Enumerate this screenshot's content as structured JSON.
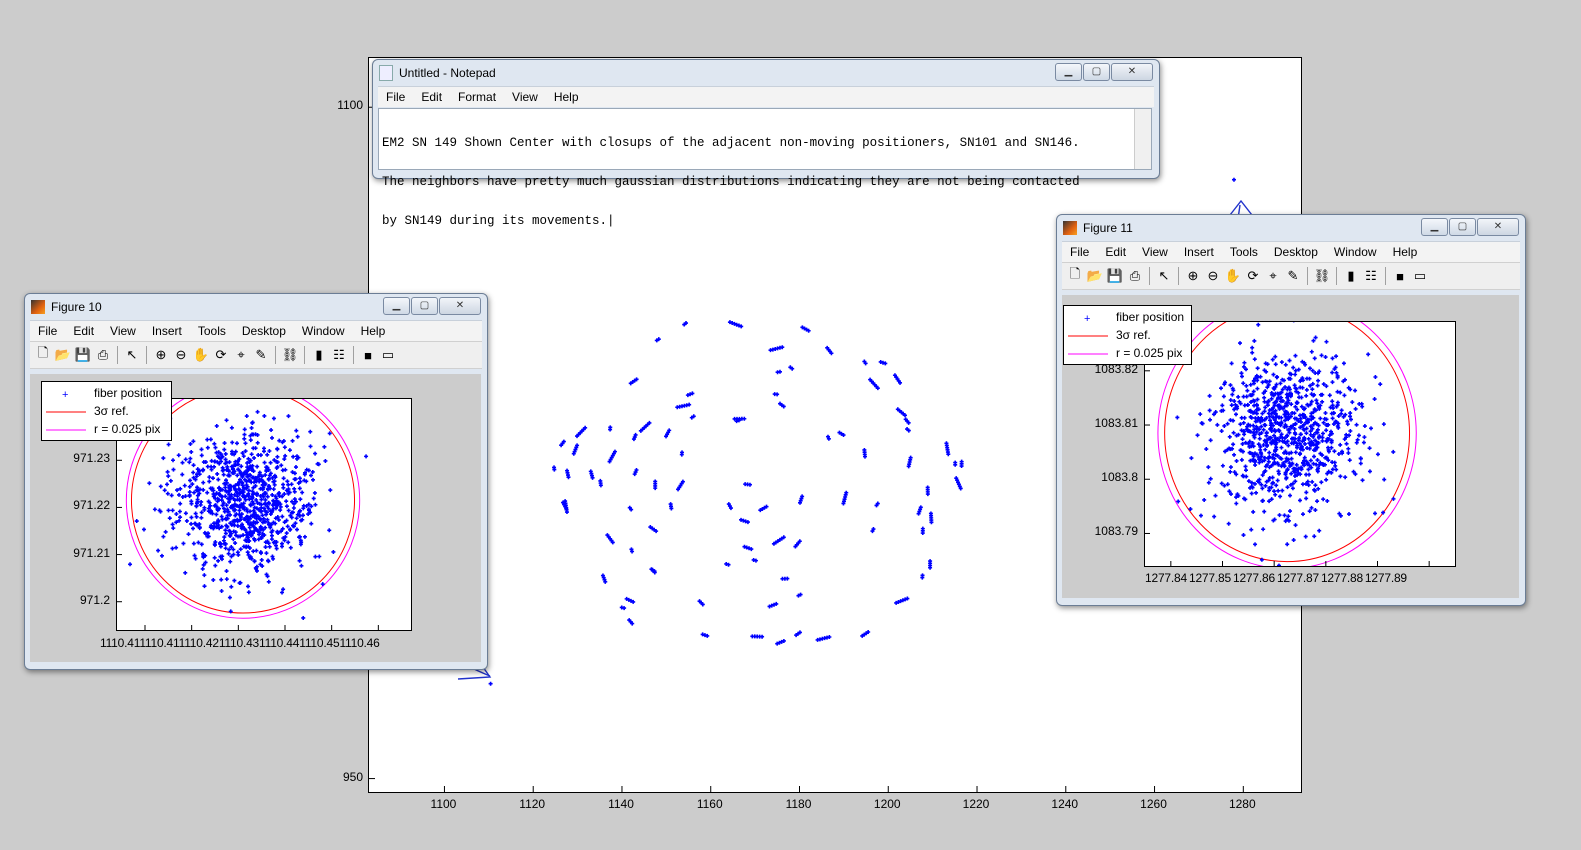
{
  "notepad": {
    "title": "Untitled - Notepad",
    "menu": [
      "File",
      "Edit",
      "Format",
      "View",
      "Help"
    ],
    "text_lines": [
      "EM2 SN 149 Shown Center with closups of the adjacent non-moving positioners, SN101 and SN146.",
      "The neighbors have pretty much gaussian distributions indicating they are not being contacted",
      "by SN149 during its movements.|"
    ]
  },
  "figure10": {
    "title": "Figure 10",
    "menu": [
      "File",
      "Edit",
      "View",
      "Insert",
      "Tools",
      "Desktop",
      "Window",
      "Help"
    ],
    "legend": [
      "fiber position",
      "3σ ref.",
      "r = 0.025 pix"
    ]
  },
  "figure11": {
    "title": "Figure 11",
    "menu": [
      "File",
      "Edit",
      "View",
      "Insert",
      "Tools",
      "Desktop",
      "Window",
      "Help"
    ],
    "legend": [
      "fiber position",
      "3σ ref.",
      "r = 0.025 pix"
    ]
  },
  "colors": {
    "points": "#0000ff",
    "sigma_circle": "#ff0000",
    "radius_circle": "#ff00ff",
    "annotation_arrow": "#2233cc"
  },
  "icons": [
    "notepad-icon",
    "matlab-icon",
    "minimize-icon",
    "maximize-icon",
    "close-icon",
    "new-icon",
    "open-icon",
    "save-icon",
    "print-icon",
    "pointer-icon",
    "zoom-in-icon",
    "zoom-out-icon",
    "pan-icon",
    "rotate-icon",
    "datacursor-icon",
    "brush-icon",
    "link-icon",
    "colorbar-icon",
    "legend-icon",
    "hide-icon",
    "dock-icon"
  ],
  "chart_data": [
    {
      "name": "main",
      "type": "scatter",
      "xlim": [
        1083,
        1293
      ],
      "ylim": [
        947,
        1111
      ],
      "xticks": [
        1100,
        1120,
        1140,
        1160,
        1180,
        1200,
        1220,
        1240,
        1260,
        1280
      ],
      "yticks": [
        950,
        1100
      ],
      "xtick_labels": [
        "1100",
        "1120",
        "1140",
        "1160",
        "1180",
        "1200",
        "1220",
        "1240",
        "1260",
        "1280"
      ],
      "ytick_labels": [
        "950",
        "1100"
      ],
      "grid": false,
      "marker": "+",
      "center": [
        1169,
        1015
      ],
      "rx": 48,
      "ry": 39,
      "extra_points": [
        [
          1110.4,
          971.2
        ],
        [
          1277.9,
          1083.8
        ]
      ]
    },
    {
      "name": "figure10",
      "type": "scatter",
      "xlim": [
        1110.404,
        1110.467
      ],
      "ylim": [
        971.194,
        971.243
      ],
      "xticks": [
        1110.41,
        1110.42,
        1110.43,
        1110.44,
        1110.45,
        1110.46
      ],
      "yticks": [
        971.2,
        971.21,
        971.22,
        971.23
      ],
      "xtick_labels": [
        "1110.41",
        "1110.41",
        "1110.42",
        "1110.43",
        "1110.44",
        "1110.45",
        "1110.46"
      ],
      "ytick_labels": [
        "971.2",
        "971.21",
        "971.22",
        "971.23"
      ],
      "center": [
        1110.431,
        971.2215
      ],
      "sigma_radius": 0.0239,
      "r_radius": 0.025,
      "grid": false,
      "legend_position": "top-left"
    },
    {
      "name": "figure11",
      "type": "scatter",
      "xlim": [
        1277.835,
        1277.895
      ],
      "ylim": [
        1083.784,
        1083.829
      ],
      "xticks": [
        1277.84,
        1277.85,
        1277.86,
        1277.87,
        1277.88,
        1277.89
      ],
      "yticks": [
        1083.79,
        1083.8,
        1083.81,
        1083.82
      ],
      "xtick_labels": [
        "1277.84",
        "1277.85",
        "1277.86",
        "1277.87",
        "1277.88",
        "1277.89"
      ],
      "ytick_labels": [
        "1083.79",
        "1083.8",
        "1083.81",
        "1083.82"
      ],
      "center": [
        1277.8625,
        1083.8085
      ],
      "sigma_radius": 0.0237,
      "r_radius": 0.025,
      "grid": false,
      "legend_position": "top-left"
    }
  ]
}
